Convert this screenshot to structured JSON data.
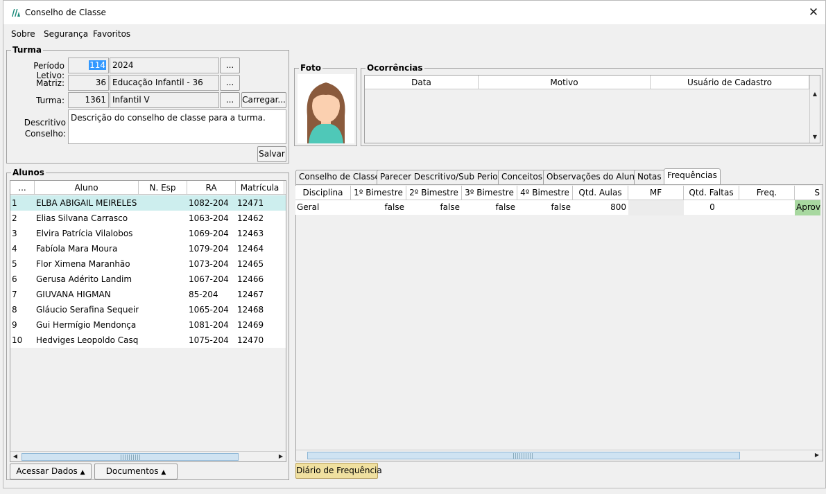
{
  "window": {
    "title": "Conselho de Classe"
  },
  "menu": [
    "Sobre",
    "Segurança",
    "Favoritos"
  ],
  "turma": {
    "group_title": "Turma",
    "periodo_label": "Período Letivo:",
    "periodo_code": "114",
    "periodo_name": "2024",
    "matriz_label": "Matriz:",
    "matriz_code": "36",
    "matriz_name": "Educação Infantil - 36",
    "turma_label": "Turma:",
    "turma_code": "1361",
    "turma_name": "Infantil V",
    "browse_label": "...",
    "carregar_label": "Carregar...",
    "descritivo_label_1": "Descritivo",
    "descritivo_label_2": "Conselho:",
    "descritivo_value": "Descrição do conselho de classe para a turma.",
    "salvar_label": "Salvar"
  },
  "foto": {
    "group_title": "Foto"
  },
  "ocorrencias": {
    "group_title": "Ocorrências",
    "columns": [
      "Data",
      "Motivo",
      "Usuário de Cadastro"
    ]
  },
  "alunos": {
    "group_title": "Alunos",
    "columns": [
      "...",
      "Aluno",
      "N. Esp",
      "RA",
      "Matrícula"
    ],
    "rows": [
      [
        "1",
        "ELBA ABIGAIL MEIRELES",
        "",
        "1082-204",
        "12471"
      ],
      [
        "2",
        "Elias Silvana Carrasco",
        "",
        "1063-204",
        "12462"
      ],
      [
        "3",
        "Elvira Patrícia Vilalobos",
        "",
        "1069-204",
        "12463"
      ],
      [
        "4",
        "Fabíola Mara Moura",
        "",
        "1079-204",
        "12464"
      ],
      [
        "5",
        "Flor Ximena Maranhão",
        "",
        "1073-204",
        "12465"
      ],
      [
        "6",
        "Gerusa Adérito Landim",
        "",
        "1067-204",
        "12466"
      ],
      [
        "7",
        "GIUVANA HIGMAN",
        "",
        "85-204",
        "12467"
      ],
      [
        "8",
        "Gláucio Serafina Sequeira",
        "",
        "1065-204",
        "12468"
      ],
      [
        "9",
        "Gui Hermígio Mendonça",
        "",
        "1081-204",
        "12469"
      ],
      [
        "10",
        "Hedviges Leopoldo Casqu...",
        "",
        "1075-204",
        "12470"
      ]
    ],
    "acessar_label": "Acessar Dados",
    "documentos_label": "Documentos"
  },
  "tabs": [
    "Conselho de Classe",
    "Parecer Descritivo/Sub Periodo",
    "Conceitos",
    "Observações do Aluno",
    "Notas",
    "Frequências"
  ],
  "frequencias": {
    "columns": [
      "Disciplina",
      "1º Bimestre",
      "2º Bimestre",
      "3º Bimestre",
      "4º Bimestre",
      "Qtd. Aulas",
      "MF",
      "Qtd. Faltas",
      "Freq.",
      "Situ"
    ],
    "row": [
      "Geral",
      "false",
      "false",
      "false",
      "false",
      "800",
      "",
      "0",
      "",
      "Aprova"
    ],
    "diario_label": "Diário de Frequência"
  },
  "colors": {
    "selected_row": "#cdeeee",
    "approved": "#a8d8a0",
    "diario_btn": "#f0e0a0",
    "selection": "#3399ff"
  },
  "icons": [
    "app-logo-icon",
    "close-icon",
    "ellipsis-icon",
    "avatar-icon",
    "triangle-up-icon",
    "scroll-up-icon",
    "scroll-down-icon",
    "scroll-left-icon",
    "scroll-right-icon"
  ]
}
